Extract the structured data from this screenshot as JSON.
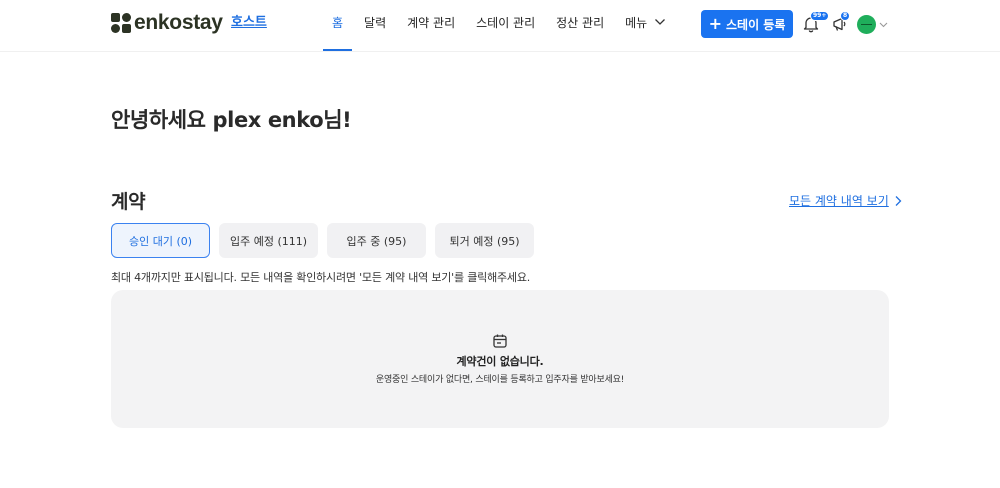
{
  "header": {
    "logo_text": "enkostay",
    "host_link": "호스트",
    "nav": [
      {
        "label": "홈",
        "active": true
      },
      {
        "label": "달력"
      },
      {
        "label": "계약 관리"
      },
      {
        "label": "스테이 관리"
      },
      {
        "label": "정산 관리"
      },
      {
        "label": "메뉴"
      }
    ],
    "register_button": "스테이 등록",
    "notifications_badge": "99+",
    "wishlist_badge": "8"
  },
  "main": {
    "greeting": "안녕하세요 plex enko님!",
    "contracts": {
      "title": "계약",
      "view_all_link": "모든 계약 내역 보기",
      "tabs": [
        {
          "label": "승인 대기 (0)",
          "active": true
        },
        {
          "label": "입주 예정 (111)"
        },
        {
          "label": "입주 중 (95)"
        },
        {
          "label": "퇴거 예정 (95)"
        }
      ],
      "notice": "최대 4개까지만 표시됩니다. 모든 내역을 확인하시려면 '모든 계약 내역 보기'를 클릭해주세요.",
      "empty_title": "계약건이 없습니다.",
      "empty_description": "운영중인 스테이가 없다면, 스테이를 등록하고 입주자를 받아보세요!"
    }
  },
  "colors": {
    "accent": "#1a73f0",
    "logo": "#2c3324",
    "empty_bg": "#f3f3f4"
  },
  "icons": [
    "logo-mark-icon",
    "chevron-down-icon",
    "plus-icon",
    "bell-icon",
    "megaphone-icon",
    "chevron-right-icon",
    "calendar-icon"
  ]
}
